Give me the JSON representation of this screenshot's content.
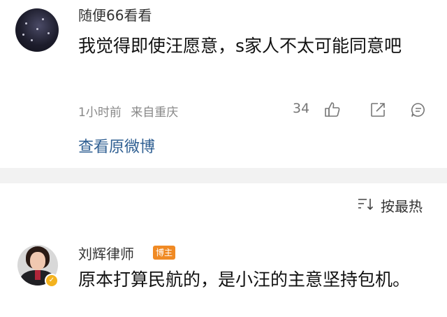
{
  "comment_top": {
    "username": "随便66看看",
    "text": "我觉得即使汪愿意，s家人不太可能同意吧",
    "time": "1小时前",
    "location": "来自重庆",
    "like_count": "34",
    "view_original": "查看原微博"
  },
  "sort": {
    "label": "按最热"
  },
  "comment_second": {
    "username": "刘辉律师",
    "tag": "博主",
    "text": "原本打算民航的，是小汪的主意坚持包机。"
  },
  "icons": {
    "like": "thumbs-up-icon",
    "share": "share-icon",
    "comment": "comment-icon",
    "sort": "sort-icon",
    "verified": "verified-badge-icon"
  },
  "colors": {
    "link": "#2f5f92",
    "tag": "#f08a24",
    "verified": "#f3b21e",
    "divider": "#f2f2f2"
  }
}
